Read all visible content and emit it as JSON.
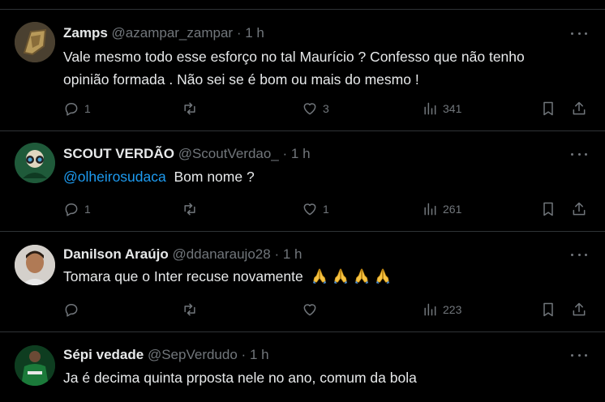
{
  "tweets": [
    {
      "name": "Zamps",
      "handle": "@azampar_zampar",
      "dot": "·",
      "time": "1 h",
      "text_line1": "Vale mesmo todo esse esforço no tal Maurício ? Confesso que não tenho",
      "text_line2": "opinião formada . Não sei se é bom ou mais do mesmo !",
      "replies": "1",
      "retweets": "",
      "likes": "3",
      "views": "341"
    },
    {
      "name": "SCOUT VERDÃO",
      "handle": "@ScoutVerdao_",
      "dot": "·",
      "time": "1 h",
      "mention": "@olheirosudaca",
      "text": "Bom nome ?",
      "replies": "1",
      "retweets": "",
      "likes": "1",
      "views": "261"
    },
    {
      "name": "Danilson Araújo",
      "handle": "@ddanaraujo28",
      "dot": "·",
      "time": "1 h",
      "text": "Tomara que o Inter recuse novamente",
      "emoji_name": "folded-hands",
      "emoji_count": 4,
      "replies": "",
      "retweets": "",
      "likes": "",
      "views": "223"
    },
    {
      "name": "Sépi vedade",
      "handle": "@SepVerdudo",
      "dot": "·",
      "time": "1 h",
      "text": "Ja é decima quinta prposta nele no ano, comum da bola"
    }
  ],
  "colors": {
    "background": "#000000",
    "text": "#e7e9ea",
    "muted": "#71767b",
    "link": "#1d9bf0",
    "border": "#2f3336"
  }
}
